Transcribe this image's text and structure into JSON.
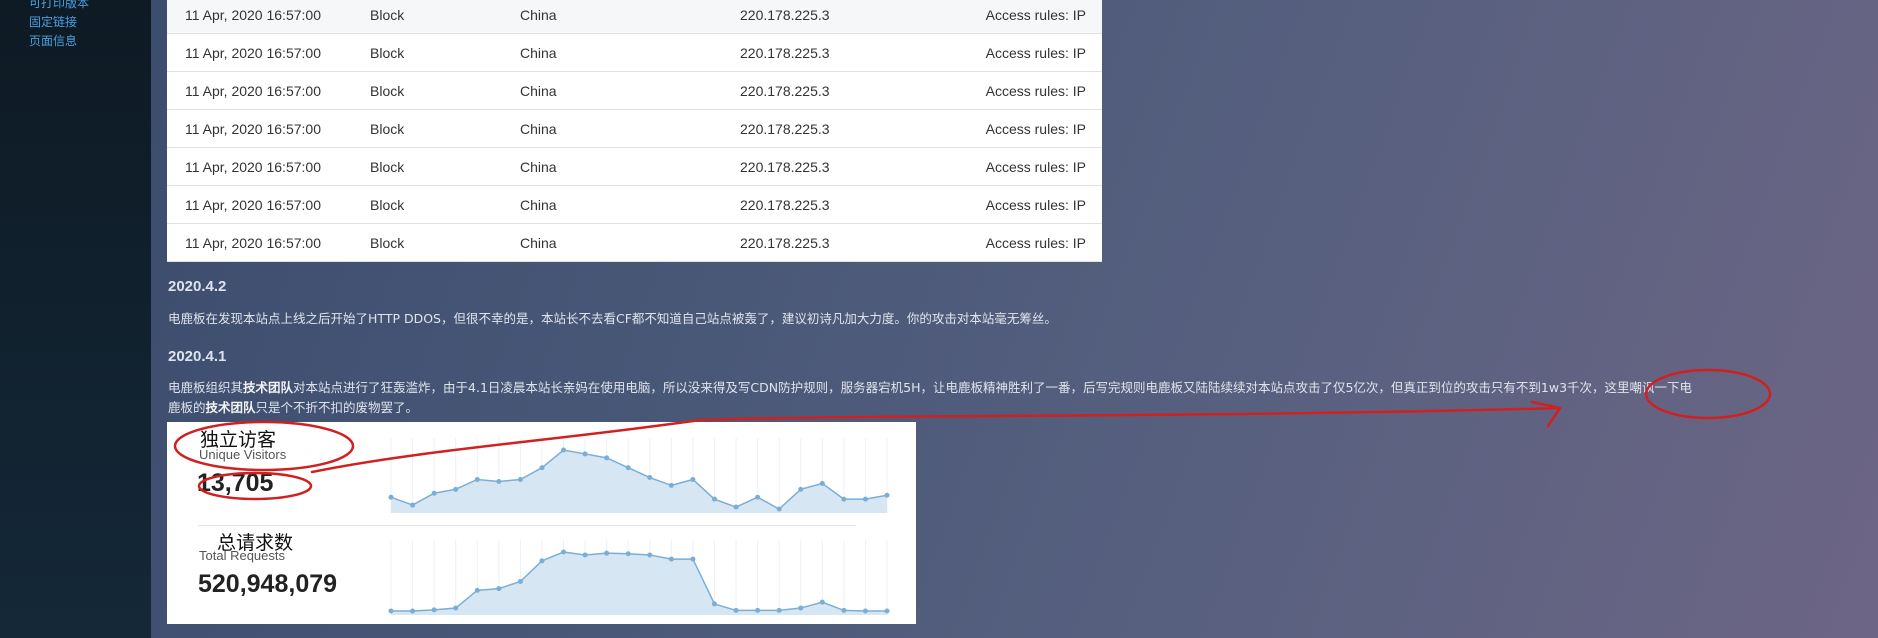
{
  "sidebar": {
    "links": [
      "可打印版本",
      "固定链接",
      "页面信息"
    ]
  },
  "firewall_log": {
    "rows": [
      [
        "11 Apr, 2020 16:57:00",
        "Block",
        "China",
        "220.178.225.3",
        "Access rules: IP"
      ],
      [
        "11 Apr, 2020 16:57:00",
        "Block",
        "China",
        "220.178.225.3",
        "Access rules: IP"
      ],
      [
        "11 Apr, 2020 16:57:00",
        "Block",
        "China",
        "220.178.225.3",
        "Access rules: IP"
      ],
      [
        "11 Apr, 2020 16:57:00",
        "Block",
        "China",
        "220.178.225.3",
        "Access rules: IP"
      ],
      [
        "11 Apr, 2020 16:57:00",
        "Block",
        "China",
        "220.178.225.3",
        "Access rules: IP"
      ],
      [
        "11 Apr, 2020 16:57:00",
        "Block",
        "China",
        "220.178.225.3",
        "Access rules: IP"
      ],
      [
        "11 Apr, 2020 16:57:00",
        "Block",
        "China",
        "220.178.225.3",
        "Access rules: IP"
      ]
    ]
  },
  "article": {
    "sections": [
      {
        "date": "2020.4.2",
        "text": "电鹿板在发现本站点上线之后开始了HTTP DDOS，但很不幸的是，本站长不去看CF都不知道自己站点被轰了，建议初诗凡加大力度。你的攻击对本站毫无筹丝。"
      },
      {
        "date": "2020.4.1",
        "text_line1_a": "电鹿板组织其",
        "text_line1_b": "技术团队",
        "text_line1_c": "对本站点进行了狂轰滥炸，由于4.1日凌晨本站长亲妈在使用电脑，所以没来得及写CDN防护规则，服务器宕机5H，让电鹿板精神胜利了一番，后写完规则电鹿板又陆陆续续对本站点攻击了仅5亿次，但真正到位的攻击只有不到1w3千次，这里嘲讽一下电",
        "text_line2_a": "鹿板的",
        "text_line2_b": "技术团队",
        "text_line2_c": "只是个不折不扣的废物罢了。"
      }
    ]
  },
  "stats": {
    "unique_visitors": {
      "label_zh": "独立访客",
      "label_en": "Unique Visitors",
      "value": "13,705",
      "series": [
        3,
        1,
        4,
        5,
        7.5,
        7,
        7.5,
        10.5,
        15,
        14,
        13,
        10.5,
        8,
        6,
        7.5,
        2.5,
        0.5,
        3,
        0,
        5,
        6.5,
        2.5,
        2.5,
        3.5
      ]
    },
    "total_requests": {
      "label_zh": "总请求数",
      "label_en": "Total Requests",
      "value": "520,948,079",
      "series": [
        0,
        0,
        0.2,
        0.5,
        3.5,
        3.8,
        5,
        8.5,
        10,
        9.5,
        9.8,
        9.7,
        9.5,
        8.8,
        8.8,
        1.2,
        0.1,
        0.1,
        0.1,
        0.5,
        1.5,
        0.1,
        0,
        0
      ]
    }
  },
  "colors": {
    "sparkline_stroke": "#7aaed6",
    "sparkline_fill": "#d6e6f3",
    "annotation": "#d02020",
    "link": "#4aa0e0"
  }
}
